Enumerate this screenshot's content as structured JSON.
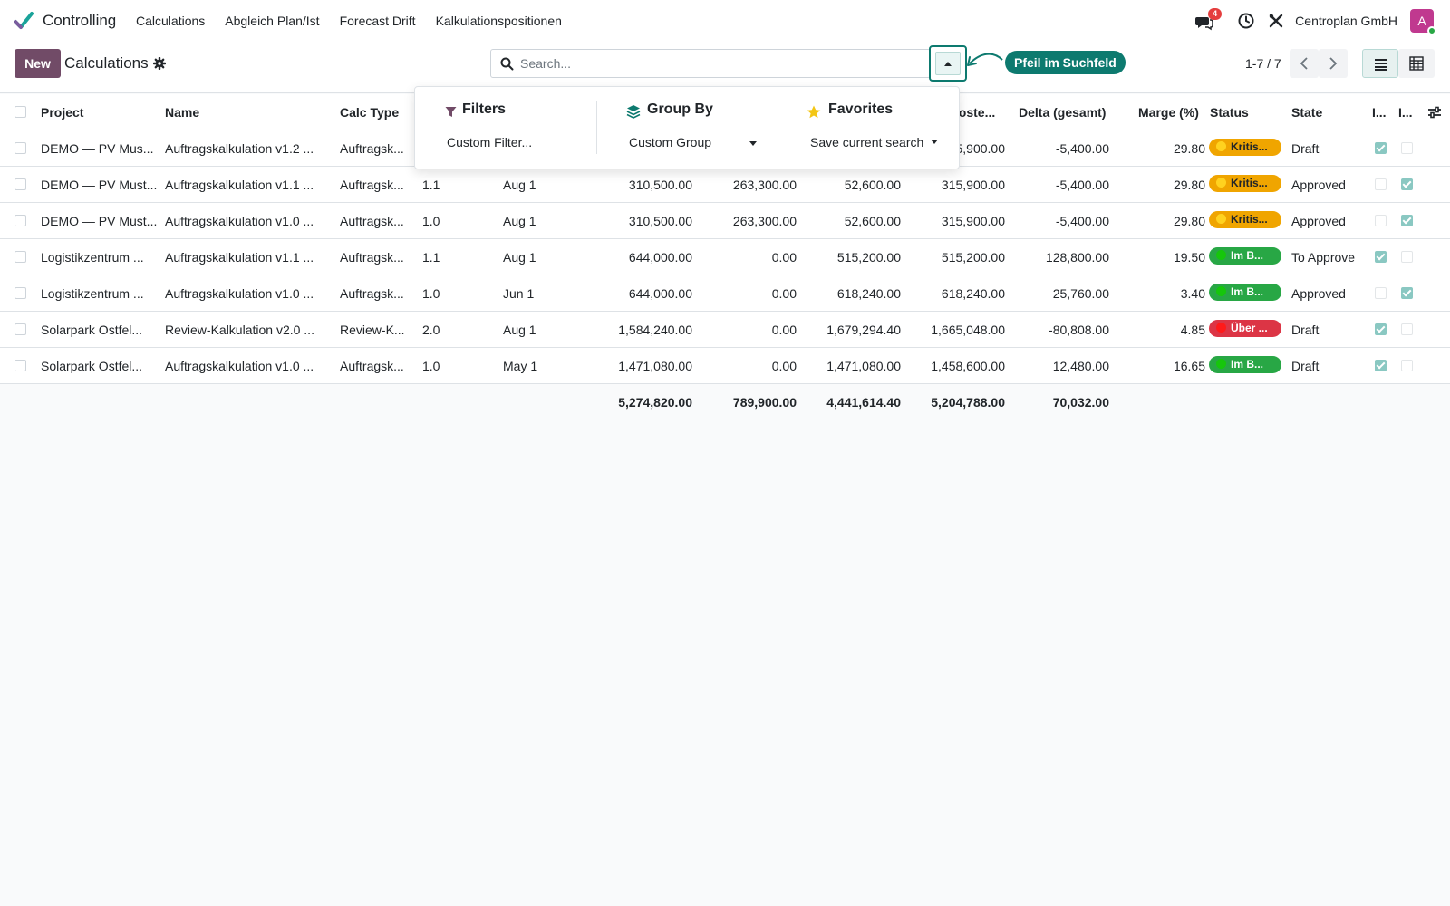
{
  "navbar": {
    "app_name": "Controlling",
    "menu": [
      "Calculations",
      "Abgleich Plan/Ist",
      "Forecast Drift",
      "Kalkulationspositionen"
    ],
    "chat_badge": "4",
    "company": "Centroplan GmbH",
    "avatar_letter": "A"
  },
  "control_panel": {
    "new_label": "New",
    "title": "Calculations",
    "search_placeholder": "Search...",
    "annotation": "Pfeil im Suchfeld",
    "pager": "1-7 / 7"
  },
  "dropdown": {
    "filters": {
      "title": "Filters",
      "item": "Custom Filter..."
    },
    "group_by": {
      "title": "Group By",
      "item": "Custom Group"
    },
    "favorites": {
      "title": "Favorites",
      "item": "Save current search"
    }
  },
  "table": {
    "headers": {
      "project": "Project",
      "name": "Name",
      "calc_type": "Calc Type",
      "koste": "koste...",
      "delta": "Delta (gesamt)",
      "marge": "Marge (%)",
      "status": "Status",
      "state": "State",
      "col_i1": "I...",
      "col_i2": "I..."
    },
    "rows": [
      {
        "project": "DEMO — PV Mus...",
        "name": "Auftragskalkulation v1.2 ...",
        "calc_type": "Auftragsk...",
        "version": "",
        "date": "",
        "v1": "",
        "v2": "",
        "v3": "",
        "v4": "315,900.00",
        "delta": "-5,400.00",
        "marge": "29.80",
        "status": "Kritis...",
        "status_kind": "yellow",
        "state": "Draft",
        "i1": true,
        "i2": false
      },
      {
        "project": "DEMO — PV Must...",
        "name": "Auftragskalkulation v1.1 ...",
        "calc_type": "Auftragsk...",
        "version": "1.1",
        "date": "Aug 1",
        "v1": "310,500.00",
        "v2": "263,300.00",
        "v3": "52,600.00",
        "v4": "315,900.00",
        "delta": "-5,400.00",
        "marge": "29.80",
        "status": "Kritis...",
        "status_kind": "yellow",
        "state": "Approved",
        "i1": false,
        "i2": true
      },
      {
        "project": "DEMO — PV Must...",
        "name": "Auftragskalkulation v1.0 ...",
        "calc_type": "Auftragsk...",
        "version": "1.0",
        "date": "Aug 1",
        "v1": "310,500.00",
        "v2": "263,300.00",
        "v3": "52,600.00",
        "v4": "315,900.00",
        "delta": "-5,400.00",
        "marge": "29.80",
        "status": "Kritis...",
        "status_kind": "yellow",
        "state": "Approved",
        "i1": false,
        "i2": true
      },
      {
        "project": "Logistikzentrum ...",
        "name": "Auftragskalkulation v1.1 ...",
        "calc_type": "Auftragsk...",
        "version": "1.1",
        "date": "Aug 1",
        "v1": "644,000.00",
        "v2": "0.00",
        "v3": "515,200.00",
        "v4": "515,200.00",
        "delta": "128,800.00",
        "marge": "19.50",
        "status": "Im B...",
        "status_kind": "green",
        "state": "To Approve",
        "i1": true,
        "i2": false
      },
      {
        "project": "Logistikzentrum ...",
        "name": "Auftragskalkulation v1.0 ...",
        "calc_type": "Auftragsk...",
        "version": "1.0",
        "date": "Jun 1",
        "v1": "644,000.00",
        "v2": "0.00",
        "v3": "618,240.00",
        "v4": "618,240.00",
        "delta": "25,760.00",
        "marge": "3.40",
        "status": "Im B...",
        "status_kind": "green",
        "state": "Approved",
        "i1": false,
        "i2": true
      },
      {
        "project": "Solarpark Ostfel...",
        "name": "Review-Kalkulation v2.0 ...",
        "calc_type": "Review-K...",
        "version": "2.0",
        "date": "Aug 1",
        "v1": "1,584,240.00",
        "v2": "0.00",
        "v3": "1,679,294.40",
        "v4": "1,665,048.00",
        "delta": "-80,808.00",
        "marge": "4.85",
        "status": "Über ...",
        "status_kind": "red",
        "state": "Draft",
        "i1": true,
        "i2": false
      },
      {
        "project": "Solarpark Ostfel...",
        "name": "Auftragskalkulation v1.0 ...",
        "calc_type": "Auftragsk...",
        "version": "1.0",
        "date": "May 1",
        "v1": "1,471,080.00",
        "v2": "0.00",
        "v3": "1,471,080.00",
        "v4": "1,458,600.00",
        "delta": "12,480.00",
        "marge": "16.65",
        "status": "Im B...",
        "status_kind": "green",
        "state": "Draft",
        "i1": true,
        "i2": false
      }
    ],
    "totals": {
      "v1": "5,274,820.00",
      "v2": "789,900.00",
      "v3": "4,441,614.40",
      "v4": "5,204,788.00",
      "delta": "70,032.00"
    }
  },
  "colors": {
    "brand": "#714b67",
    "accent": "#0d7a6f",
    "status_yellow_bg": "#f0a500",
    "status_green_bg": "#28a745",
    "status_red_bg": "#dc3545"
  }
}
